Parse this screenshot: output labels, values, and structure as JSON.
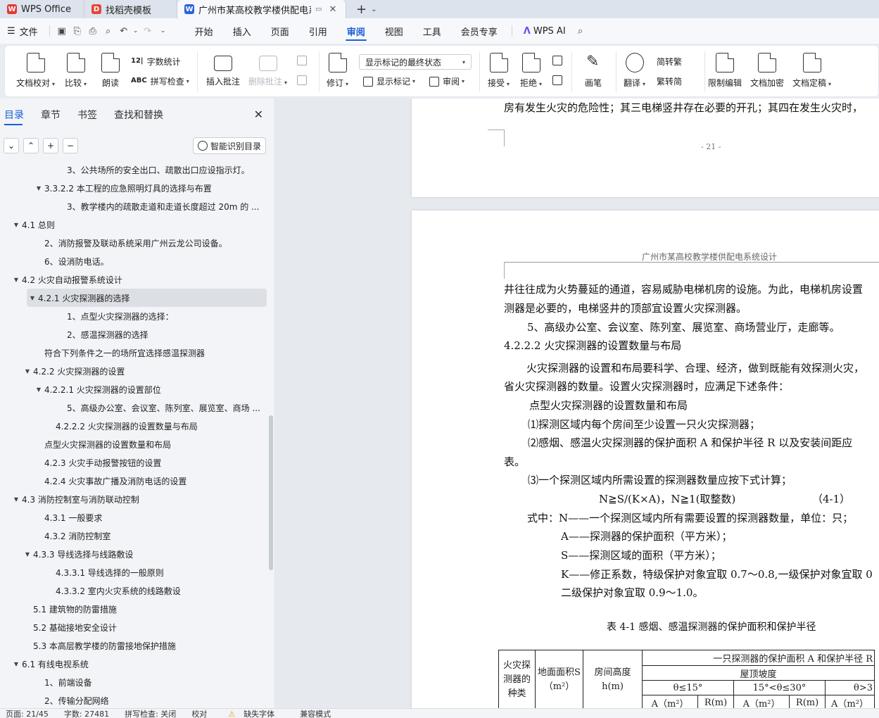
{
  "tabs": [
    {
      "label": "WPS Office",
      "logo": "W",
      "logo_color": "#e13a36"
    },
    {
      "label": "找稻壳模板",
      "logo": "D",
      "logo_color": "#e4473a"
    },
    {
      "label": "广州市某高校教学楼供配电系",
      "logo": "W",
      "logo_color": "#2b63d9"
    }
  ],
  "menu": {
    "file": "文件",
    "tabs": [
      "开始",
      "插入",
      "页面",
      "引用",
      "审阅",
      "视图",
      "工具",
      "会员专享"
    ],
    "active": "审阅",
    "ai_label": "WPS AI"
  },
  "ribbon": {
    "doc_check": "文档校对",
    "compare": "比较",
    "read_aloud": "朗读",
    "word_count": "字数统计",
    "spell_check": "拼写检查",
    "insert_comment": "插入批注",
    "delete_comment": "删除批注",
    "track_changes": "修订",
    "display_mode": "显示标记的最终状态",
    "show_markup": "显示标记",
    "review_pane": "审阅",
    "accept": "接受",
    "reject": "拒绝",
    "ink": "画笔",
    "translate": "翻译",
    "to_traditional": "简转繁",
    "to_simplified": "繁转简",
    "restrict_edit": "限制编辑",
    "encrypt": "文档加密",
    "finalize": "文档定稿"
  },
  "panel": {
    "tabs": [
      "目录",
      "章节",
      "书签",
      "查找和替换"
    ],
    "active_tab": "目录",
    "smart_toc": "智能识别目录",
    "toc": [
      {
        "label": "3、公共场所的安全出口、疏散出口应设指示灯。",
        "indent": 95,
        "tri": ""
      },
      {
        "label": "3.3.2.2 本工程的应急照明灯具的选择与布置",
        "indent": 63,
        "tri": "▼"
      },
      {
        "label": "3、教学楼内的疏散走道和走道长度超过 20m 的 ...",
        "indent": 95,
        "tri": ""
      },
      {
        "label": "4.1  总则",
        "indent": 31,
        "tri": "▼"
      },
      {
        "label": "2、消防报警及联动系统采用广州云龙公司设备。",
        "indent": 63,
        "tri": ""
      },
      {
        "label": "6、设消防电话。",
        "indent": 63,
        "tri": ""
      },
      {
        "label": "4.2  火灾自动报警系统设计",
        "indent": 31,
        "tri": "▼"
      },
      {
        "label": "4.2.1  火灾探测器的选择",
        "indent": 47,
        "tri": "▼",
        "selected": true
      },
      {
        "label": "1、点型火灾探测器的选择：",
        "indent": 95,
        "tri": ""
      },
      {
        "label": "2、感温探测器的选择",
        "indent": 95,
        "tri": ""
      },
      {
        "label": "符合下列条件之一的场所宜选择感温探测器",
        "indent": 63,
        "tri": ""
      },
      {
        "label": "4.2.2  火灾探测器的设置",
        "indent": 47,
        "tri": "▼"
      },
      {
        "label": "4.2.2.1 火灾探测器的设置部位",
        "indent": 63,
        "tri": "▼"
      },
      {
        "label": "5、高级办公室、会议室、陈列室、展览室、商场 ...",
        "indent": 95,
        "tri": ""
      },
      {
        "label": "4.2.2.2 火灾探测器的设置数量与布局",
        "indent": 79,
        "tri": ""
      },
      {
        "label": "点型火灾探测器的设置数量和布局",
        "indent": 63,
        "tri": ""
      },
      {
        "label": "4.2.3  火灾手动报警按钮的设置",
        "indent": 63,
        "tri": ""
      },
      {
        "label": "4.2.4  火灾事故广播及消防电话的设置",
        "indent": 63,
        "tri": ""
      },
      {
        "label": "4.3  消防控制室与消防联动控制",
        "indent": 31,
        "tri": "▼"
      },
      {
        "label": "4.3.1  一般要求",
        "indent": 63,
        "tri": ""
      },
      {
        "label": "4.3.2  消防控制室",
        "indent": 63,
        "tri": ""
      },
      {
        "label": "4.3.3  导线选择与线路敷设",
        "indent": 47,
        "tri": "▼"
      },
      {
        "label": "4.3.3.1  导线选择的一般原则",
        "indent": 79,
        "tri": ""
      },
      {
        "label": "4.3.3.2  室内火灾系统的线路敷设",
        "indent": 79,
        "tri": ""
      },
      {
        "label": "5.1  建筑物的防雷措施",
        "indent": 47,
        "tri": ""
      },
      {
        "label": "5.2  基础接地安全设计",
        "indent": 47,
        "tri": ""
      },
      {
        "label": "5.3  本高层教学楼的防雷接地保护措施",
        "indent": 47,
        "tri": ""
      },
      {
        "label": "6.1  有线电视系统",
        "indent": 31,
        "tri": "▼"
      },
      {
        "label": "1、前端设备",
        "indent": 63,
        "tri": ""
      },
      {
        "label": "2、传输分配网络",
        "indent": 63,
        "tri": ""
      }
    ]
  },
  "doc": {
    "page1_tail": "房有发生火灾的危险性；其三电梯竖井存在必要的开孔；其四在发生火灾时，",
    "page_number": "- 21 -",
    "header": "广州市某高校教学楼供配电系统设计",
    "lines": [
      "井往往成为火势蔓延的通道，容易威胁电梯机房的设施。为此，电梯机房设置",
      "测器是必要的，电梯竖井的顶部宜设置火灾探测器。",
      "5、高级办公室、会议室、陈列室、展览室、商场营业厅，走廊等。",
      "4.2.2.2 火灾探测器的设置数量与布局",
      "火灾探测器的设置和布局要科学、合理、经济，做到既能有效探测火灾，",
      "省火灾探测器的数量。设置火灾探测器时，应满足下述条件：",
      "点型火灾探测器的设置数量和布局",
      "⑴探测区域内每个房间至少设置一只火灾探测器；",
      "⑵感烟、感温火灾探测器的保护面积 A 和保护半径 R 以及安装间距应",
      "表。",
      "⑶一个探测区域内所需设置的探测器数量应按下式计算；",
      "N≧S/(K×A)，N≧1(取整数)",
      "（4-1）",
      "式中：N——一个探测区域内所有需要设置的探测器数量，单位：只；",
      "A——探测器的保护面积（平方米）；",
      "S——探测区域的面积（平方米）；",
      "K——修正系数，特级保护对象宜取 0.7～0.8,一级保护对象宜取 0",
      "二级保护对象宜取 0.9～1.0。",
      "表 4-1 感烟、感温探测器的保护面积和保护半径"
    ],
    "table": {
      "c1": "火灾探测器的种类",
      "c2": "地面面积S（m²）",
      "c3": "房间高度h(m)",
      "group": "一只探测器的保护面积 A 和保护半径 R",
      "slope": "屋顶坡度",
      "t1": "θ≤15°",
      "t2": "15°<θ≤30°",
      "t3": "θ>3",
      "a": "A（m²）",
      "r": "R(m)"
    }
  },
  "status": {
    "page": "页面: 21/45",
    "words": "字数: 27481",
    "spell": "拼写检查: 关闭",
    "proof": "校对",
    "missing_font": "缺失字体",
    "compat": "兼容模式"
  }
}
